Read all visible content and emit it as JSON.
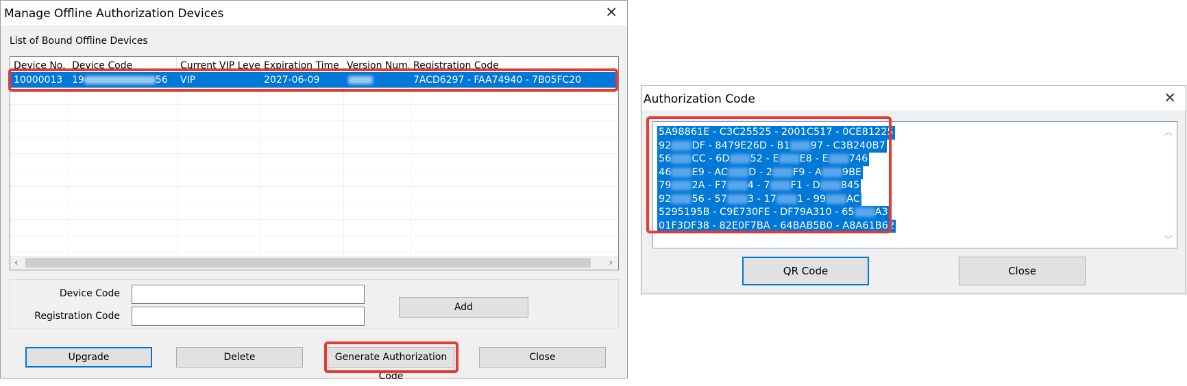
{
  "left_dialog": {
    "title": "Manage Offline Authorization Devices",
    "group_label": "List of Bound Offline Devices",
    "columns": [
      "Device No.",
      "Device Code",
      "Current VIP Level",
      "Expiration Time",
      "Version Num...",
      "Registration Code"
    ],
    "row": {
      "device_no": "10000013",
      "device_code_start": "19",
      "device_code_end": "56",
      "vip_level": "VIP",
      "expiration": "2027-06-09",
      "registration_code": "7ACD6297 - FAA74940 - 7B05FC20"
    },
    "device_code_label": "Device Code",
    "registration_code_label": "Registration Code",
    "add_button": "Add",
    "upgrade_button": "Upgrade",
    "delete_button": "Delete",
    "generate_button": "Generate Authorization Code",
    "close_button": "Close"
  },
  "right_dialog": {
    "title": "Authorization Code",
    "lines": [
      [
        "5A98861E - C3C25525 - 2001C517 - 0CE81225"
      ],
      [
        "92",
        "",
        "DF - 8479E26D - B1",
        "",
        "97 - C3B240B7"
      ],
      [
        "56",
        "",
        "CC - 6D",
        "",
        "52 - E",
        "",
        "E8 - E",
        "",
        "746"
      ],
      [
        "46",
        "",
        "E9 - AC",
        "",
        "D - 2",
        "",
        "F9 - A",
        "",
        "9BE"
      ],
      [
        "79",
        "",
        "2A - F7",
        "",
        "4 - 7",
        "",
        "F1 - D",
        "",
        "845"
      ],
      [
        "92",
        "",
        "56 - 57",
        "",
        "3 - 17",
        "",
        "1 - 99",
        "",
        "AC"
      ],
      [
        "5295195B - C9E730FE - DF79A310 - 65",
        "",
        "A3"
      ],
      [
        "01F3DF38 - 82E0F7BA - 64BAB5B0 - A8A61B62"
      ]
    ],
    "qr_button": "QR Code",
    "close_button": "Close"
  },
  "colors": {
    "selection": "#0078d7",
    "highlight": "#e53935",
    "dialog_bg": "#f0f0f0"
  },
  "icons": {
    "close": "close-icon",
    "scroll_left": "chevron-left-icon",
    "scroll_right": "chevron-right-icon",
    "scroll_up": "chevron-up-icon",
    "scroll_down": "chevron-down-icon"
  }
}
